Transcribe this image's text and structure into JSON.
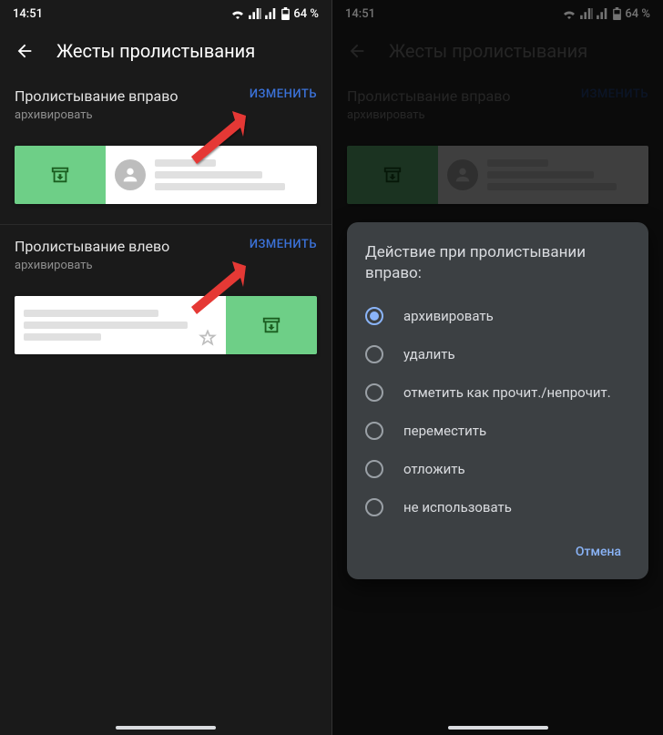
{
  "status": {
    "time": "14:51",
    "battery": "64 %"
  },
  "appbar": {
    "title": "Жесты пролистывания"
  },
  "left_screen": {
    "swipe_right": {
      "title": "Пролистывание вправо",
      "sub": "архивировать",
      "change": "ИЗМЕНИТЬ"
    },
    "swipe_left": {
      "title": "Пролистывание влево",
      "sub": "архивировать",
      "change": "ИЗМЕНИТЬ"
    }
  },
  "right_screen": {
    "swipe_right": {
      "title": "Пролистывание вправо",
      "sub": "архивировать",
      "change": "ИЗМЕНИТЬ"
    },
    "dialog": {
      "title": "Действие при пролистывании вправо:",
      "options": [
        {
          "label": "архивировать",
          "selected": true
        },
        {
          "label": "удалить",
          "selected": false
        },
        {
          "label": "отметить как прочит./непрочит.",
          "selected": false
        },
        {
          "label": "переместить",
          "selected": false
        },
        {
          "label": "отложить",
          "selected": false
        },
        {
          "label": "не использовать",
          "selected": false
        }
      ],
      "cancel": "Отмена"
    }
  }
}
